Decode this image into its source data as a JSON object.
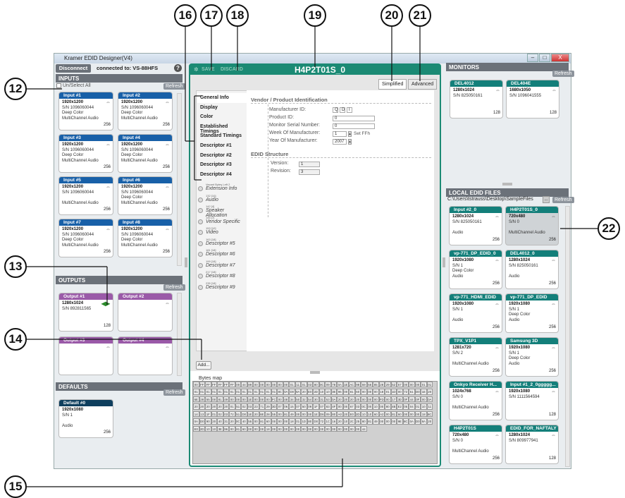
{
  "callouts": {
    "c12": "12",
    "c13": "13",
    "c14": "14",
    "c15": "15",
    "c16": "16",
    "c17": "17",
    "c18": "18",
    "c19": "19",
    "c20": "20",
    "c21": "21",
    "c22": "22"
  },
  "window": {
    "title": "Kramer EDID Designer(V4)",
    "minimize": "–",
    "maximize": "□",
    "close": "X"
  },
  "toolbar": {
    "disconnect": "Disconnect",
    "connected": "connected to: VS-88HFS",
    "help": "?"
  },
  "inputs": {
    "title": "INPUTS",
    "select_all": "Un/Select All",
    "refresh": "Refresh",
    "cards": [
      {
        "title": "Input #1",
        "res": "1920x1200",
        "sn": "S/N 1096060044",
        "l3": "Deep Color",
        "l4": "MultiChannel Audio",
        "count": "256"
      },
      {
        "title": "Input #2",
        "res": "1920x1200",
        "sn": "S/N 1096060044",
        "l3": "Deep Color",
        "l4": "MultiChannel Audio",
        "count": "256"
      },
      {
        "title": "Input #3",
        "res": "1920x1200",
        "sn": "S/N 1096060044",
        "l3": "Deep Color",
        "l4": "MultiChannel Audio",
        "count": "256"
      },
      {
        "title": "Input #4",
        "res": "1920x1200",
        "sn": "S/N 1096060044",
        "l3": "Deep Color",
        "l4": "MultiChannel Audio",
        "count": "256"
      },
      {
        "title": "Input #5",
        "res": "1920x1200",
        "sn": "S/N 1096060044",
        "l3": "",
        "l4": "MultiChannel Audio",
        "count": "256"
      },
      {
        "title": "Input #6",
        "res": "1920x1200",
        "sn": "S/N 1096060044",
        "l3": "Deep Color",
        "l4": "MultiChannel Audio",
        "count": "256"
      },
      {
        "title": "Input #7",
        "res": "1920x1200",
        "sn": "S/N 1096060044",
        "l3": "Deep Color",
        "l4": "MultiChannel Audio",
        "count": "256"
      },
      {
        "title": "Input #8",
        "res": "1920x1200",
        "sn": "S/N 1096060044",
        "l3": "Deep Color",
        "l4": "MultiChannel Audio",
        "count": "256"
      }
    ]
  },
  "outputs": {
    "title": "OUTPUTS",
    "refresh": "Refresh",
    "cards": [
      {
        "title": "Output #1",
        "res": "1280x1024",
        "sn": "S/N 892811565",
        "count": "128"
      },
      {
        "title": "Output #2"
      },
      {
        "title": "Output #3"
      },
      {
        "title": "Output #4"
      }
    ]
  },
  "defaults": {
    "title": "DEFAULTS",
    "refresh": "Refresh",
    "card": {
      "title": "Default #0",
      "res": "1920x1080",
      "sn": "S/N 1",
      "l3": "Audio",
      "count": "256"
    }
  },
  "editor": {
    "save": "SAVE",
    "discard": "DISCARD",
    "title": "H4P2T01S_0",
    "tab_simplified": "Simplified",
    "tab_advanced": "Advanced",
    "nav": [
      "General Info",
      "Display",
      "Color",
      "Established Timings",
      "Standard Timings",
      "Descriptor #1",
      "Descriptor #2",
      "Descriptor #3",
      "Descriptor #4"
    ],
    "ext": [
      {
        "n": "Vacant Bytes Left 2",
        "t": "Extension Info"
      },
      {
        "n": "132 [10]",
        "t": "Audio"
      },
      {
        "n": "142 [4]",
        "t": "Speaker Allocation"
      },
      {
        "n": "146 [7]",
        "t": "Vendor Specific"
      },
      {
        "n": "153 [10]",
        "t": "Video"
      },
      {
        "n": "163 [18]",
        "t": "Descriptor #5"
      },
      {
        "n": "181 [18]",
        "t": "Descriptor #6"
      },
      {
        "n": "199 [18]",
        "t": "Descriptor #7"
      },
      {
        "n": "217 [18]",
        "t": "Descriptor #8"
      },
      {
        "n": "235 [18]",
        "t": "Descriptor #9"
      }
    ],
    "add": "Add...",
    "vendor_heading": "Vendor / Product Identification",
    "manufacturer_label": "Manufacturer ID:",
    "manufacturer": [
      "Q",
      "D",
      "I"
    ],
    "product_label": "Product ID:",
    "product": "0",
    "serial_label": "Monitor Serial Number:",
    "serial": "0",
    "week_label": "Week Of Manufacturer:",
    "week": "1",
    "set_ffh": "Set FFh",
    "year_label": "Year Of Manufacturer:",
    "year": "2007",
    "structure_heading": "EDID Structure",
    "version_label": "Version:",
    "version": "1",
    "revision_label": "Revision:",
    "revision": "3",
    "bytes_label": "Bytes map"
  },
  "bytes": [
    "00",
    "FF",
    "FF",
    "FF",
    "FF",
    "FF",
    "FF",
    "00",
    "44",
    "89",
    "00",
    "00",
    "00",
    "00",
    "00",
    "00",
    "01",
    "11",
    "01",
    "03",
    "80",
    "0C",
    "09",
    "78",
    "0A",
    "1E",
    "AC",
    "98",
    "59",
    "56",
    "85",
    "28",
    "29",
    "52",
    "57",
    "00",
    "00",
    "00",
    "01",
    "01",
    "01",
    "01",
    "01",
    "01",
    "01",
    "01",
    "01",
    "01",
    "01",
    "01",
    "01",
    "01",
    "01",
    "01",
    "8C",
    "0A",
    "D0",
    "8A",
    "20",
    "E0",
    "2D",
    "10",
    "10",
    "3E",
    "96",
    "00",
    "81",
    "60",
    "00",
    "00",
    "00",
    "18",
    "01",
    "1D",
    "00",
    "72",
    "51",
    "D0",
    "1E",
    "20",
    "6E",
    "28",
    "55",
    "00",
    "81",
    "49",
    "00",
    "00",
    "00",
    "1E",
    "00",
    "00",
    "00",
    "FC",
    "00",
    "48",
    "34",
    "50",
    "32",
    "54",
    "30",
    "31",
    "53",
    "0A",
    "20",
    "20",
    "20",
    "20",
    "00",
    "00",
    "00",
    "FD",
    "00",
    "17",
    "3D",
    "0F",
    "44",
    "0F",
    "00",
    "0A",
    "20",
    "20",
    "20",
    "20",
    "20",
    "20",
    "01",
    "51",
    "02",
    "03",
    "23",
    "71",
    "29",
    "3D",
    "07",
    "06",
    "15",
    "07",
    "50",
    "09",
    "1F",
    "07",
    "83",
    "4F",
    "00",
    "00",
    "67",
    "03",
    "0C",
    "00",
    "10",
    "00",
    "80",
    "4B",
    "E2",
    "05",
    "04",
    "01",
    "10",
    "11",
    "14",
    "13",
    "1F",
    "01",
    "02",
    "03",
    "72",
    "51",
    "D0",
    "1E",
    "20",
    "6E",
    "28",
    "55",
    "00",
    "81",
    "49",
    "00",
    "00",
    "00",
    "1E",
    "D6",
    "09",
    "80",
    "A0",
    "20",
    "E0",
    "2D",
    "10",
    "10",
    "60",
    "A2",
    "00",
    "81",
    "60",
    "00",
    "00",
    "00",
    "18",
    "8C",
    "0A",
    "D0",
    "90",
    "20",
    "40",
    "31",
    "20",
    "0C",
    "40",
    "55",
    "00",
    "81",
    "60",
    "00",
    "00",
    "00",
    "18",
    "01",
    "1D",
    "80",
    "D0",
    "72",
    "1C",
    "16",
    "20",
    "10",
    "2C",
    "25",
    "80",
    "81",
    "49",
    "00",
    "00",
    "00",
    "9E",
    "8C",
    "0A",
    "D0",
    "8A",
    "20",
    "E0",
    "2D",
    "10",
    "10",
    "3E",
    "96",
    "00",
    "81",
    "60",
    "00",
    "00",
    "00",
    "18",
    "00",
    "00",
    "00",
    "00",
    "00",
    "00",
    "00",
    "00",
    "00",
    "00",
    "00",
    "00",
    "00",
    "00",
    "00",
    "44"
  ],
  "monitors": {
    "title": "MONITORS",
    "refresh": "Refresh",
    "cards": [
      {
        "title": "DEL4012",
        "res": "1280x1024",
        "sn": "S/N 825050161",
        "count": "128"
      },
      {
        "title": "DEL404E",
        "res": "1680x1050",
        "sn": "S/N 1096041555",
        "count": "128"
      }
    ]
  },
  "local": {
    "title": "LOCAL EDID FILES",
    "path": "C:\\Users\\tstrauss\\Desktop\\SampleFiles",
    "browse": "...",
    "refresh": "Refresh",
    "cards": [
      {
        "title": "Input #2_0",
        "res": "1280x1024",
        "sn": "S/N 825050161",
        "l3": "",
        "l4": "Audio",
        "count": "256",
        "color": "teal"
      },
      {
        "title": "H4P2T01S_0",
        "res": "720x480",
        "sn": "S/N 0",
        "l3": "",
        "l4": "MultiChannel Audio",
        "count": "256",
        "color": "teal"
      },
      {
        "title": "vp-771_DP_EDID_0",
        "res": "1920x1080",
        "sn": "S/N 1",
        "l3": "Deep Color",
        "l4": "Audio",
        "count": "256",
        "color": "teal"
      },
      {
        "title": "DEL4012_0",
        "res": "1280x1024",
        "sn": "S/N 825050161",
        "l3": "",
        "l4": "Audio",
        "count": "256",
        "color": "teal"
      },
      {
        "title": "vp-771_HDMI_EDID",
        "res": "1920x1080",
        "sn": "S/N 1",
        "l3": "",
        "l4": "Audio",
        "count": "256",
        "color": "teal"
      },
      {
        "title": "vp-771_DP_EDID",
        "res": "1920x1080",
        "sn": "S/N 1",
        "l3": "Deep Color",
        "l4": "Audio",
        "count": "256",
        "color": "teal"
      },
      {
        "title": "TPX_V1P1",
        "res": "1281x720",
        "sn": "S/N 2",
        "l3": "",
        "l4": "MultiChannel Audio",
        "count": "256",
        "color": "teal"
      },
      {
        "title": "Samsung 3D",
        "res": "1920x1080",
        "sn": "S/N 1",
        "l3": "Deep Color",
        "l4": "Audio",
        "count": "256",
        "color": "teal"
      },
      {
        "title": "Onkyo Receiver H...",
        "res": "1024x768",
        "sn": "S/N 0",
        "l3": "",
        "l4": "MultiChannel Audio",
        "count": "256",
        "color": "teal"
      },
      {
        "title": "Input #1_2_0ggggg...",
        "res": "1920x1080",
        "sn": "S/N 1111564594",
        "l3": "",
        "l4": "",
        "count": "128",
        "color": "teal"
      },
      {
        "title": "H4P2T01S",
        "res": "720x480",
        "sn": "S/N 0",
        "l3": "",
        "l4": "MultiChannel Audio",
        "count": "256",
        "color": "teal"
      },
      {
        "title": "EDID_FOR_NAFTALY",
        "res": "1280x1024",
        "sn": "S/N 809977941",
        "l3": "",
        "l4": "",
        "count": "128",
        "color": "teal"
      }
    ]
  }
}
